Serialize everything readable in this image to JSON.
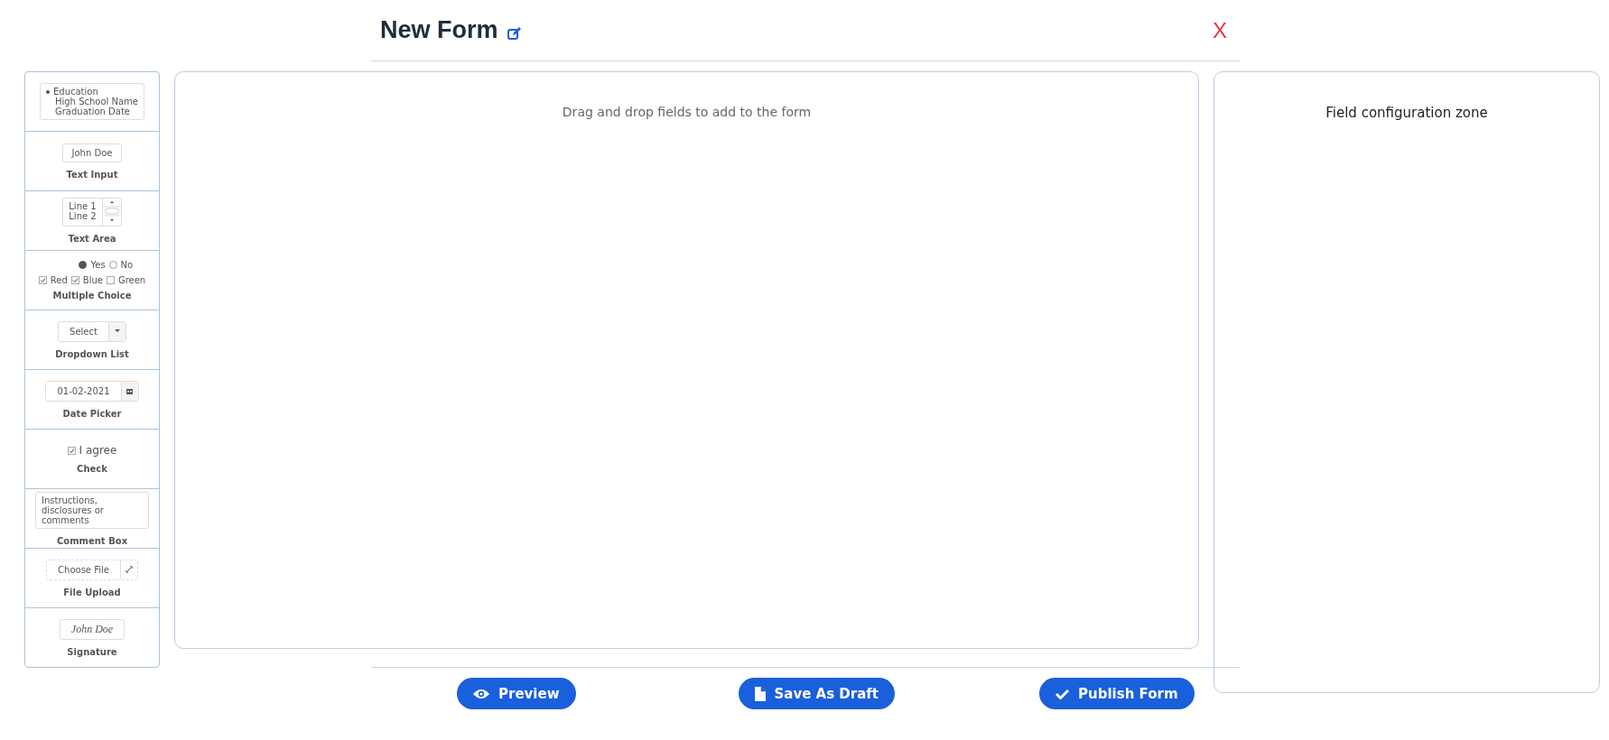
{
  "header": {
    "title": "New Form",
    "close": "X"
  },
  "palette": [
    {
      "kind": "outline",
      "heading": "Education",
      "lines": [
        "High School Name",
        "Graduation Date"
      ]
    },
    {
      "kind": "input",
      "value": "John Doe",
      "label": "Text Input"
    },
    {
      "kind": "textarea",
      "lines": [
        "Line 1",
        "Line 2"
      ],
      "label": "Text Area"
    },
    {
      "kind": "choice",
      "radios": [
        {
          "label": "Yes",
          "selected": true
        },
        {
          "label": "No",
          "selected": false
        }
      ],
      "checks": [
        {
          "label": "Red",
          "checked": true
        },
        {
          "label": "Blue",
          "checked": true
        },
        {
          "label": "Green",
          "checked": false
        }
      ],
      "label": "Multiple Choice"
    },
    {
      "kind": "dropdown",
      "value": "Select",
      "label": "Dropdown List"
    },
    {
      "kind": "date",
      "value": "01-02-2021",
      "label": "Date Picker"
    },
    {
      "kind": "check",
      "text": "I agree",
      "checked": true,
      "label": "Check"
    },
    {
      "kind": "comment",
      "value": "Instructions, disclosures or comments",
      "label": "Comment Box"
    },
    {
      "kind": "file",
      "value": "Choose File",
      "label": "File Upload"
    },
    {
      "kind": "signature",
      "value": "John Doe",
      "label": "Signature"
    }
  ],
  "canvas": {
    "hint": "Drag and drop fields to add to the form"
  },
  "config": {
    "title": "Field configuration zone"
  },
  "actions": [
    {
      "kind": "preview",
      "label": "Preview"
    },
    {
      "kind": "draft",
      "label": "Save As Draft"
    },
    {
      "kind": "publish",
      "label": "Publish Form"
    }
  ]
}
